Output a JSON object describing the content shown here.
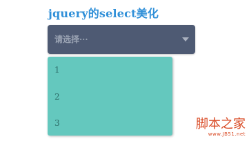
{
  "title": "jquery的select美化",
  "select": {
    "placeholder": "请选择···",
    "options": [
      "1",
      "2",
      "3"
    ]
  },
  "watermark": {
    "name": "脚本之家",
    "url": "www.JB51.net"
  },
  "colors": {
    "title": "#2f8fd8",
    "select_bg": "#4e5a73",
    "dropdown_bg": "#64c8be",
    "watermark": "#d94a24"
  },
  "icons": {
    "select_caret": "caret-down-icon"
  }
}
